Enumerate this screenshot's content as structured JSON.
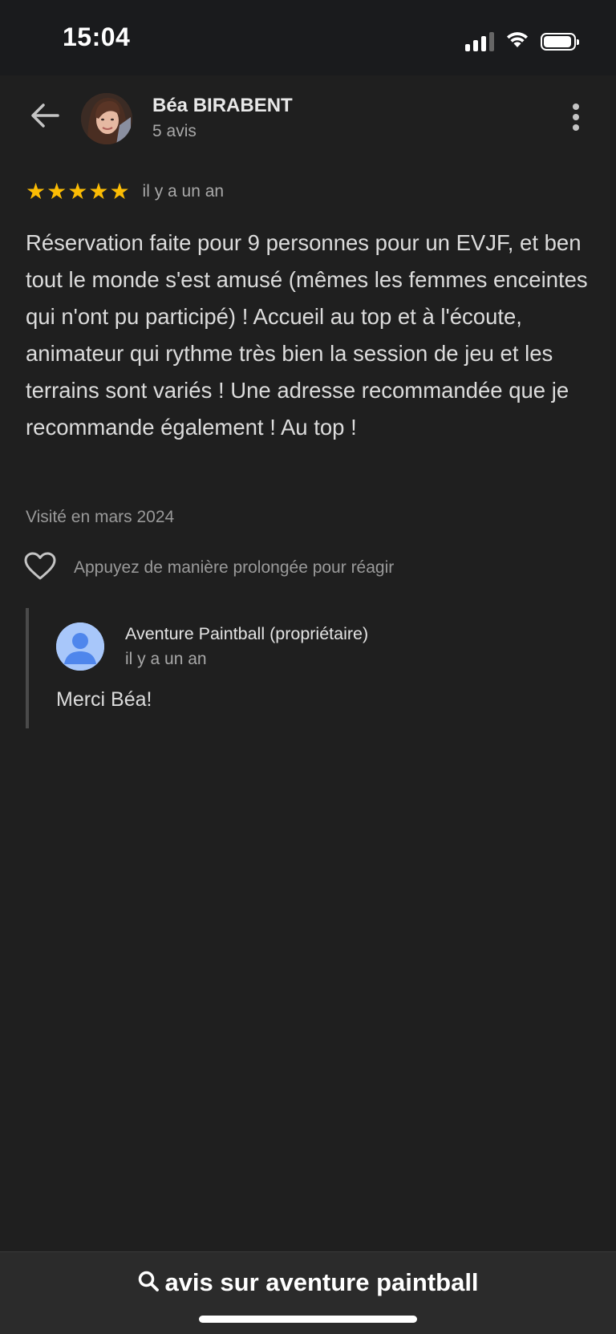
{
  "status_bar": {
    "time": "15:04",
    "icons": [
      "signal-icon",
      "wifi-icon",
      "battery-icon"
    ]
  },
  "header": {
    "back_icon": "arrow-left-icon",
    "reviewer_name": "Béa BIRABENT",
    "review_count": "5 avis",
    "more_icon": "more-vertical-icon"
  },
  "review": {
    "stars": 5,
    "star_color": "#fbbc04",
    "date": "il y a un an",
    "text": "Réservation faite pour 9 personnes pour un EVJF, et ben tout le monde s'est amusé (mêmes les femmes enceintes qui n'ont pu participé) ! Accueil au top et à l'écoute, animateur qui rythme très bien la session de jeu et les terrains sont variés ! Une adresse recommandée que je recommande également ! Au top !",
    "visited": "Visité en mars 2024",
    "react_hint": "Appuyez de manière prolongée pour réagir"
  },
  "owner_reply": {
    "name": "Aventure Paintball (propriétaire)",
    "date": "il y a un an",
    "text": "Merci Béa!"
  },
  "bottom_bar": {
    "search_icon": "search-icon",
    "query": "avis sur aventure paintball"
  }
}
